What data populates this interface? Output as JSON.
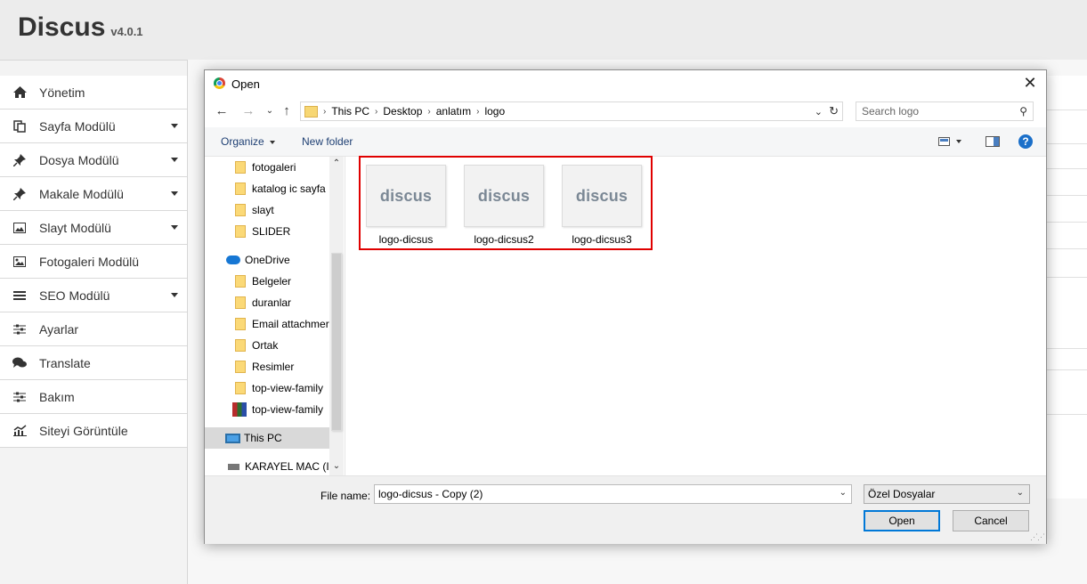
{
  "app": {
    "title": "Discus",
    "version": "v4.0.1"
  },
  "sidebar": {
    "items": [
      {
        "label": "Yönetim",
        "icon": "home-icon",
        "has_caret": false
      },
      {
        "label": "Sayfa Modülü",
        "icon": "pages-icon",
        "has_caret": true
      },
      {
        "label": "Dosya Modülü",
        "icon": "pin-icon",
        "has_caret": true
      },
      {
        "label": "Makale Modülü",
        "icon": "pin-icon",
        "has_caret": true
      },
      {
        "label": "Slayt Modülü",
        "icon": "image-icon",
        "has_caret": true
      },
      {
        "label": "Fotogaleri Modülü",
        "icon": "gallery-icon",
        "has_caret": false
      },
      {
        "label": "SEO Modülü",
        "icon": "list-icon",
        "has_caret": true
      },
      {
        "label": "Ayarlar",
        "icon": "sliders-icon",
        "has_caret": false
      },
      {
        "label": "Translate",
        "icon": "chat-icon",
        "has_caret": false
      },
      {
        "label": "Bakım",
        "icon": "sliders-icon",
        "has_caret": false
      },
      {
        "label": "Siteyi Görüntüle",
        "icon": "chart-icon",
        "has_caret": false
      }
    ]
  },
  "dialog": {
    "title": "Open",
    "breadcrumb": [
      "This PC",
      "Desktop",
      "anlatım",
      "logo"
    ],
    "search_placeholder": "Search logo",
    "toolbar": {
      "organize": "Organize",
      "new_folder": "New folder"
    },
    "nav_items": [
      {
        "label": "fotogaleri",
        "type": "folder"
      },
      {
        "label": "katalog ic sayfa",
        "type": "folder"
      },
      {
        "label": "slayt",
        "type": "folder"
      },
      {
        "label": "SLIDER",
        "type": "folder"
      },
      {
        "label": "OneDrive",
        "type": "cloud"
      },
      {
        "label": "Belgeler",
        "type": "folder"
      },
      {
        "label": "duranlar",
        "type": "folder"
      },
      {
        "label": "Email attachmer",
        "type": "folder"
      },
      {
        "label": "Ortak",
        "type": "folder"
      },
      {
        "label": "Resimler",
        "type": "folder"
      },
      {
        "label": "top-view-family",
        "type": "folder"
      },
      {
        "label": "top-view-family",
        "type": "archive"
      },
      {
        "label": "This PC",
        "type": "pc",
        "selected": true
      },
      {
        "label": "KARAYEL MAC (I:)",
        "type": "drive"
      }
    ],
    "files": [
      {
        "name": "logo-dicsus",
        "thumb_text": "discus"
      },
      {
        "name": "logo-dicsus2",
        "thumb_text": "discus"
      },
      {
        "name": "logo-dicsus3",
        "thumb_text": "discus"
      }
    ],
    "file_name_label": "File name:",
    "file_name_value": "logo-dicsus - Copy (2)",
    "file_type": "Özel Dosyalar",
    "open_label": "Open",
    "cancel_label": "Cancel",
    "highlight_color": "#e00000"
  }
}
